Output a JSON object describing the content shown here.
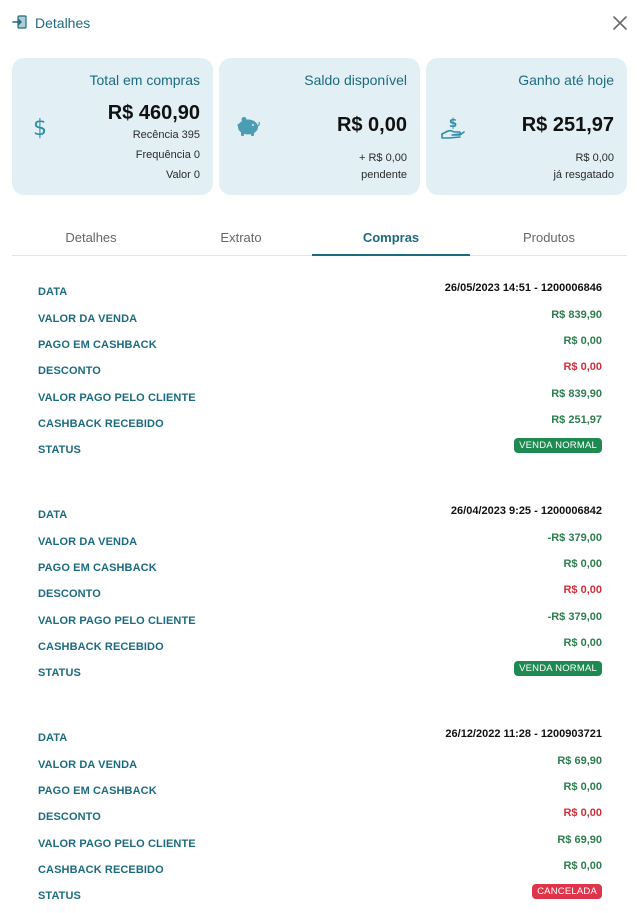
{
  "header": {
    "title": "Detalhes",
    "icon": "exit-door-icon",
    "close_icon": "close-icon"
  },
  "cards": {
    "total": {
      "title": "Total em compras",
      "value": "R$ 460,90",
      "lines": [
        "Recência 395",
        "Frequência 0",
        "Valor 0"
      ],
      "icon": "dollar-icon"
    },
    "saldo": {
      "title": "Saldo disponível",
      "value": "R$ 0,00",
      "lines": [
        "+ R$ 0,00",
        "pendente"
      ],
      "icon": "piggy-bank-icon"
    },
    "ganho": {
      "title": "Ganho até hoje",
      "value": "R$ 251,97",
      "lines": [
        "R$ 0,00",
        "já resgatado"
      ],
      "icon": "hand-money-icon"
    }
  },
  "tabs": [
    {
      "label": "Detalhes",
      "active": false
    },
    {
      "label": "Extrato",
      "active": false
    },
    {
      "label": "Compras",
      "active": true
    },
    {
      "label": "Produtos",
      "active": false
    }
  ],
  "labels": {
    "data": "DATA",
    "valor_venda": "VALOR DA VENDA",
    "pago_cashback": "PAGO EM CASHBACK",
    "desconto": "DESCONTO",
    "valor_pago": "VALOR PAGO PELO CLIENTE",
    "cashback_recebido": "CASHBACK RECEBIDO",
    "status": "STATUS"
  },
  "purchases": [
    {
      "data": "26/05/2023 14:51 - 1200006846",
      "valor_venda": "R$ 839,90",
      "pago_cashback": "R$ 0,00",
      "desconto": "R$ 0,00",
      "valor_pago": "R$ 839,90",
      "cashback_recebido": "R$ 251,97",
      "status": "VENDA NORMAL",
      "status_color": "#1e8a52"
    },
    {
      "data": "26/04/2023 9:25 - 1200006842",
      "valor_venda": "-R$ 379,00",
      "pago_cashback": "R$ 0,00",
      "desconto": "R$ 0,00",
      "valor_pago": "-R$ 379,00",
      "cashback_recebido": "R$ 0,00",
      "status": "VENDA NORMAL",
      "status_color": "#1e8a52"
    },
    {
      "data": "26/12/2022 11:28 - 1200903721",
      "valor_venda": "R$ 69,90",
      "pago_cashback": "R$ 0,00",
      "desconto": "R$ 0,00",
      "valor_pago": "R$ 69,90",
      "cashback_recebido": "R$ 0,00",
      "status": "CANCELADA",
      "status_color": "#e0344a"
    }
  ],
  "colors": {
    "accent": "#1d6b80",
    "card_bg": "#e2eff4",
    "positive": "#2e7d4f",
    "negative": "#d0303b"
  }
}
